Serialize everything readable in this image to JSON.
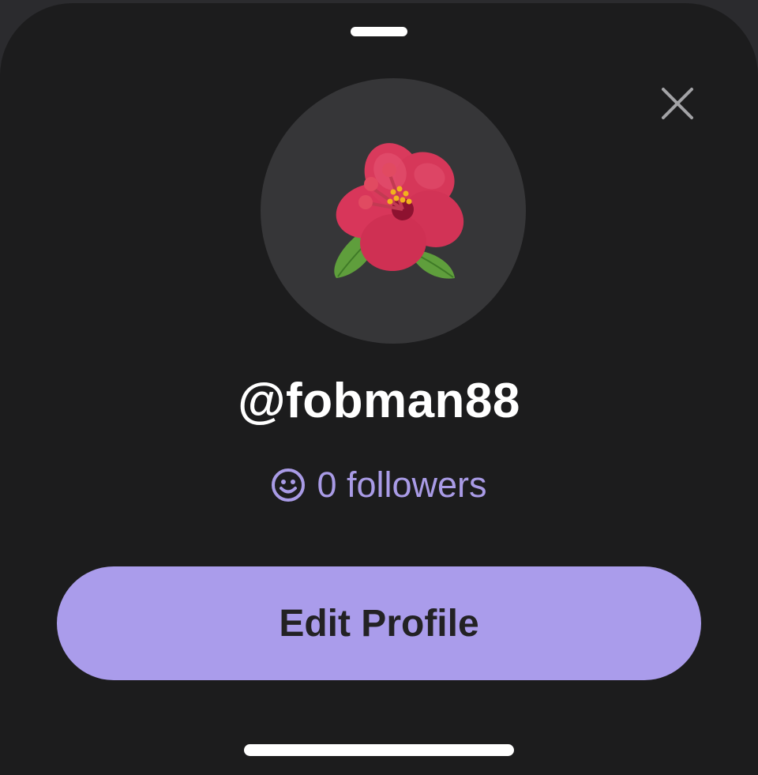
{
  "profile": {
    "username": "@fobman88",
    "followers_text": "0 followers",
    "avatar_icon": "hibiscus-flower-icon",
    "followers_icon": "smiley-icon",
    "close_icon": "close-icon"
  },
  "actions": {
    "edit_profile_label": "Edit Profile"
  },
  "colors": {
    "sheet_background": "#1c1c1d",
    "avatar_background": "#363638",
    "accent": "#aa9ceb",
    "followers_text": "#a99be6"
  }
}
